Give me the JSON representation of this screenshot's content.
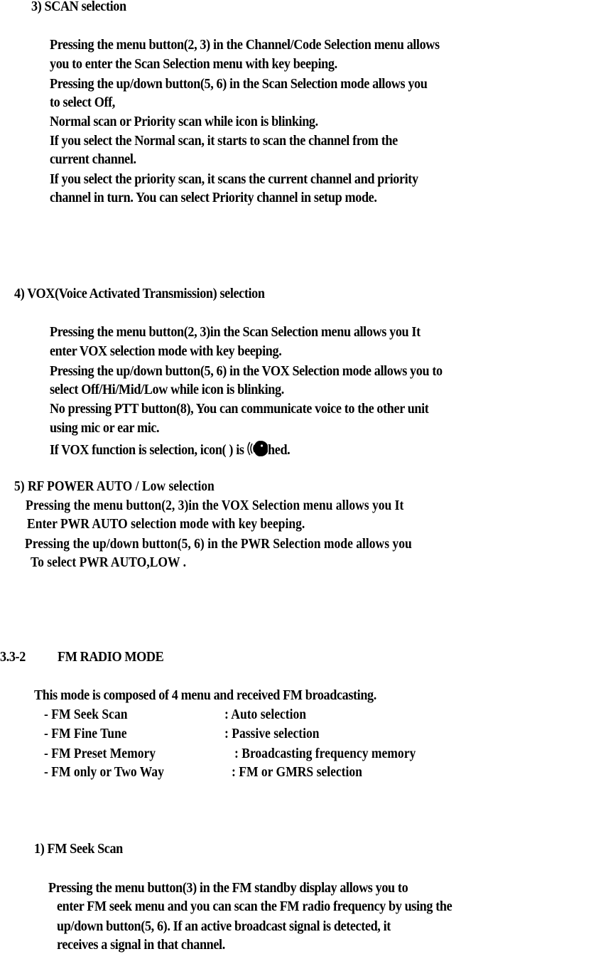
{
  "scan": {
    "heading": "3) SCAN selection",
    "lines": [
      "Pressing the menu  button(2, 3) in the Channel/Code Selection menu allows",
      "you to enter the Scan Selection menu with key beeping.",
      "Pressing the up/down button(5, 6) in the Scan Selection mode allows you",
      "to select Off,",
      "Normal scan or Priority scan while icon is blinking.",
      "If you select the Normal scan, it starts to scan the channel from the",
      "current channel.",
      "If you select the priority scan, it scans the current channel and priority",
      "channel in turn. You can select Priority channel in setup mode."
    ]
  },
  "vox": {
    "heading": "4) VOX(Voice Activated Transmission) selection",
    "lines": [
      "Pressing the menu  button(2, 3)in the Scan Selection menu allows you It",
      "enter VOX selection mode with key beeping.",
      "Pressing the up/down button(5, 6) in the VOX Selection mode allows you to",
      "select Off/Hi/Mid/Low while icon is blinking.",
      "No pressing PTT button(8), You can communicate voice to the other unit",
      "using mic or ear mic."
    ],
    "last_line_before": "If VOX function is selection, icon(       ) is",
    "last_line_after": "hed.",
    "icon": "vox-speaking-head-icon"
  },
  "rf_power": {
    "heading": "5) RF POWER AUTO / Low selection",
    "lines": [
      "Pressing the menu button(2, 3)in the VOX Selection menu allows you It",
      "Enter PWR AUTO selection mode with key beeping.",
      "Pressing the up/down button(5, 6) in the PWR Selection mode allows you",
      "To select PWR AUTO,LOW ."
    ]
  },
  "fm_mode": {
    "number": "3.3-2",
    "title": "FM RADIO MODE",
    "intro": "This mode is composed of 4 menu and received FM broadcasting.",
    "menu": [
      {
        "name": "- FM Seek Scan",
        "desc": ": Auto selection"
      },
      {
        "name": "- FM Fine Tune",
        "desc": ": Passive selection"
      },
      {
        "name": "- FM Preset Memory",
        "desc": ": Broadcasting frequency memory"
      },
      {
        "name": "- FM only or Two Way",
        "desc": ": FM or GMRS selection"
      }
    ]
  },
  "fm_seek": {
    "heading": "1)  FM Seek Scan",
    "lines": [
      "Pressing the menu  button(3) in the FM standby display allows you to",
      "enter FM seek menu and you can scan the FM radio frequency by using the",
      "up/down button(5, 6). If an active broadcast signal is detected, it",
      "receives a signal in that channel."
    ]
  }
}
